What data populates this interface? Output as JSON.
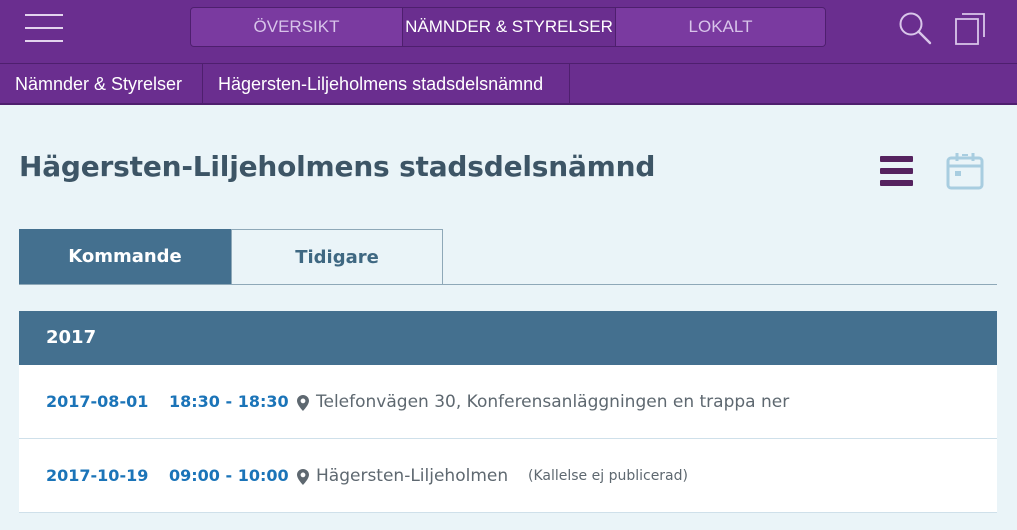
{
  "topnav": {
    "tabs": [
      "ÖVERSIKT",
      "NÄMNDER & STYRELSER",
      "LOKALT"
    ],
    "active_tab_index": 1
  },
  "breadcrumb": [
    "Nämnder & Styrelser",
    "Hägersten-Liljeholmens stadsdelsnämnd"
  ],
  "page": {
    "title": "Hägersten-Liljeholmens stadsdelsnämnd"
  },
  "view_tabs": [
    "Kommande",
    "Tidigare"
  ],
  "active_view_tab_index": 0,
  "year": "2017",
  "meetings": [
    {
      "date": "2017-08-01",
      "time": "18:30 - 18:30",
      "location": "Telefonvägen 30, Konferensanläggningen en trappa ner",
      "note": ""
    },
    {
      "date": "2017-10-19",
      "time": "09:00 - 10:00",
      "location": "Hägersten-Liljeholmen",
      "note": "(Kallelse ej publicerad)"
    }
  ],
  "icons": {
    "menu": "hamburger-menu-icon",
    "search": "search-icon",
    "copy": "copy-icon",
    "list_view": "list-view-icon",
    "calendar_view": "calendar-icon",
    "location": "map-pin-icon"
  },
  "colors": {
    "topbar": "#6a2e8f",
    "tab_active": "#44708f",
    "link_blue": "#1b74b8",
    "page_background": "#eaf4f8"
  }
}
